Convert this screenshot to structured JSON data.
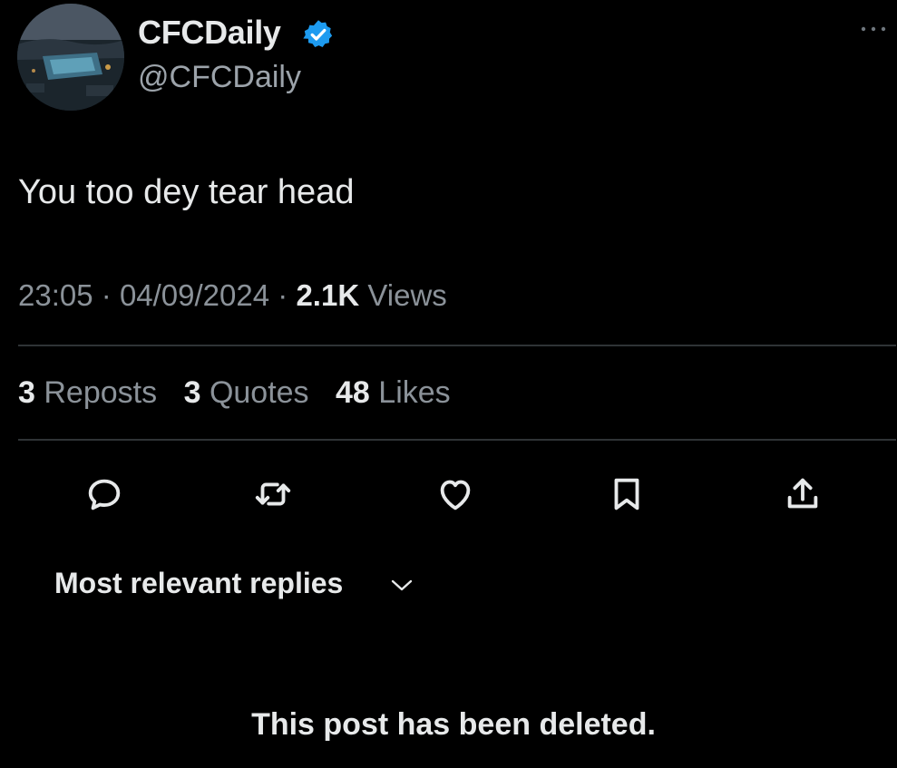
{
  "author": {
    "display_name": "CFCDaily",
    "handle": "@CFCDaily",
    "verified": true,
    "verified_color": "#1d9bf0",
    "avatar_icon": "stadium-aerial-avatar"
  },
  "post": {
    "text": "You too dey tear head",
    "time": "23:05",
    "date": "04/09/2024",
    "views_count": "2.1K",
    "views_label": "Views"
  },
  "stats": {
    "reposts_count": "3",
    "reposts_label": "Reposts",
    "quotes_count": "3",
    "quotes_label": "Quotes",
    "likes_count": "48",
    "likes_label": "Likes"
  },
  "actions": [
    "reply-icon",
    "repost-icon",
    "like-icon",
    "bookmark-icon",
    "share-icon"
  ],
  "replies": {
    "sort_label": "Most relevant replies"
  },
  "deleted_notice": "This post has been deleted.",
  "colors": {
    "background": "#000000",
    "text": "#e7e9ea",
    "muted": "#8b9299",
    "divider": "#2f3336"
  }
}
